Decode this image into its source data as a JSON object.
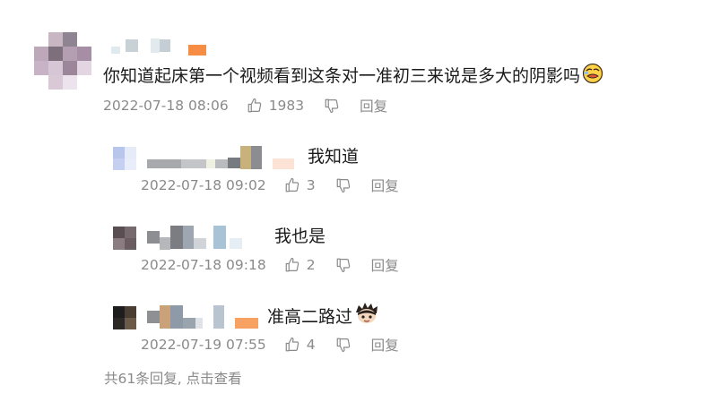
{
  "main_comment": {
    "text": "你知道起床第一个视频看到这条对一准初三来说是多大的阴影吗",
    "emoji_icon": "face-emoji-icon",
    "time": "2022-07-18 08:06",
    "likes": "1983",
    "reply_label": "回复"
  },
  "replies": [
    {
      "text": "我知道",
      "time": "2022-07-18 09:02",
      "likes": "3",
      "reply_label": "回复"
    },
    {
      "text": "我也是",
      "time": "2022-07-18 09:18",
      "likes": "2",
      "reply_label": "回复"
    },
    {
      "text": "准高二路过",
      "emoji_icon": "avatar-emoji-icon",
      "time": "2022-07-19 07:55",
      "likes": "4",
      "reply_label": "回复"
    }
  ],
  "footer": {
    "view_all": "共61条回复, 点击查看"
  },
  "icons": {
    "like": "thumbs-up-icon",
    "dislike": "thumbs-down-icon"
  },
  "colors": {
    "meta_text": "#8a8a8a",
    "accent_orange": "#f58d45"
  }
}
